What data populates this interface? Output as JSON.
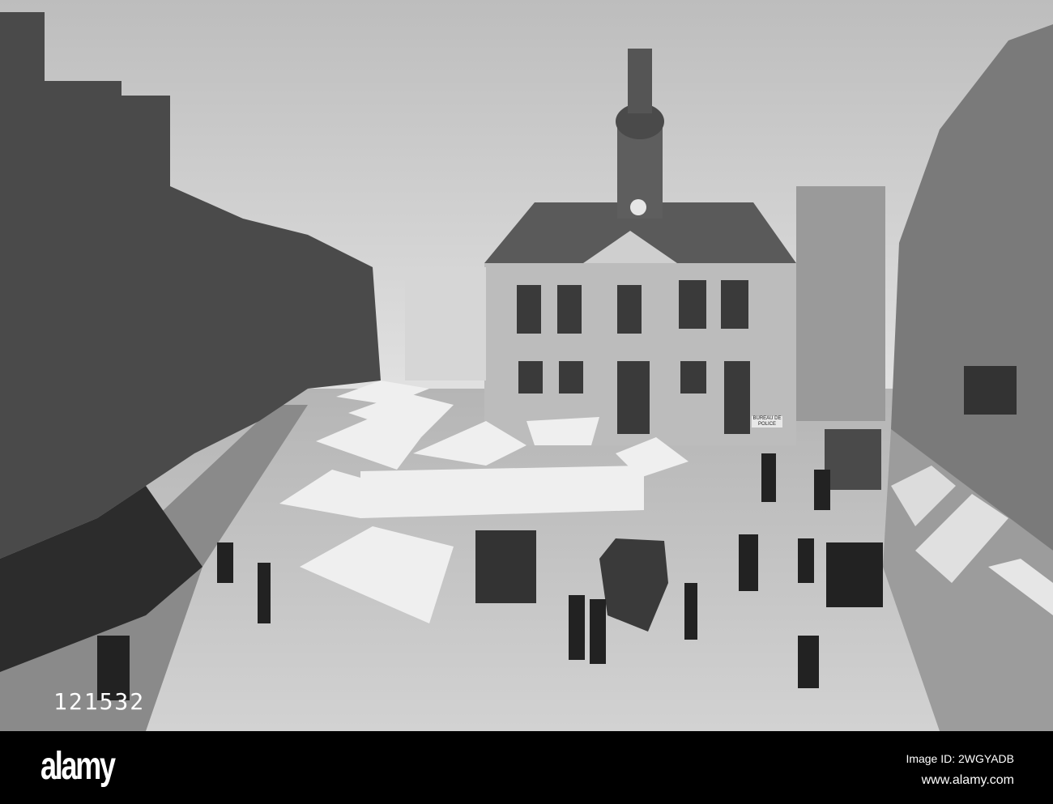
{
  "photo": {
    "plate_number": "121532",
    "sign_text": "BUREAU DE POLICE"
  },
  "footer": {
    "logo": "alamy",
    "image_id": "Image ID: 2WGYADB",
    "website": "www.alamy.com"
  }
}
